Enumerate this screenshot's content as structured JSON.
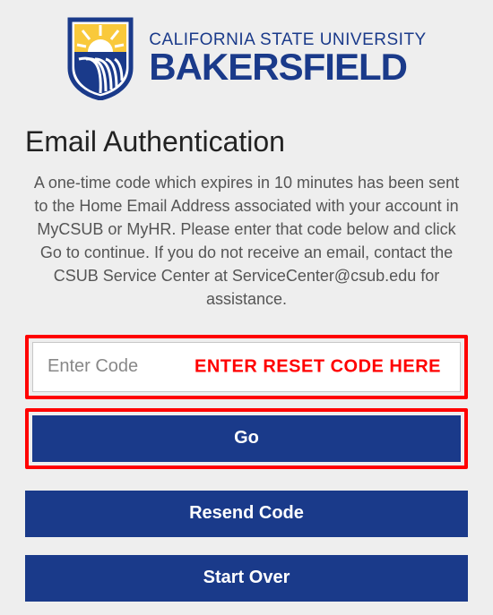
{
  "logo": {
    "top_line": "CALIFORNIA STATE UNIVERSITY",
    "bottom_line": "BAKERSFIELD"
  },
  "heading": "Email Authentication",
  "description": "A one-time code which expires in 10 minutes has been sent to the Home Email Address associated with your account in MyCSUB or MyHR. Please enter that code below and click Go to continue. If you do not receive an email, contact the CSUB Service Center at ServiceCenter@csub.edu for assistance.",
  "input": {
    "placeholder": "Enter Code",
    "value": ""
  },
  "annotation": "ENTER RESET CODE HERE",
  "buttons": {
    "go": "Go",
    "resend": "Resend Code",
    "start_over": "Start Over"
  },
  "colors": {
    "brand": "#1a3a8a",
    "highlight": "#ff0000",
    "bg": "#eeeeee"
  }
}
